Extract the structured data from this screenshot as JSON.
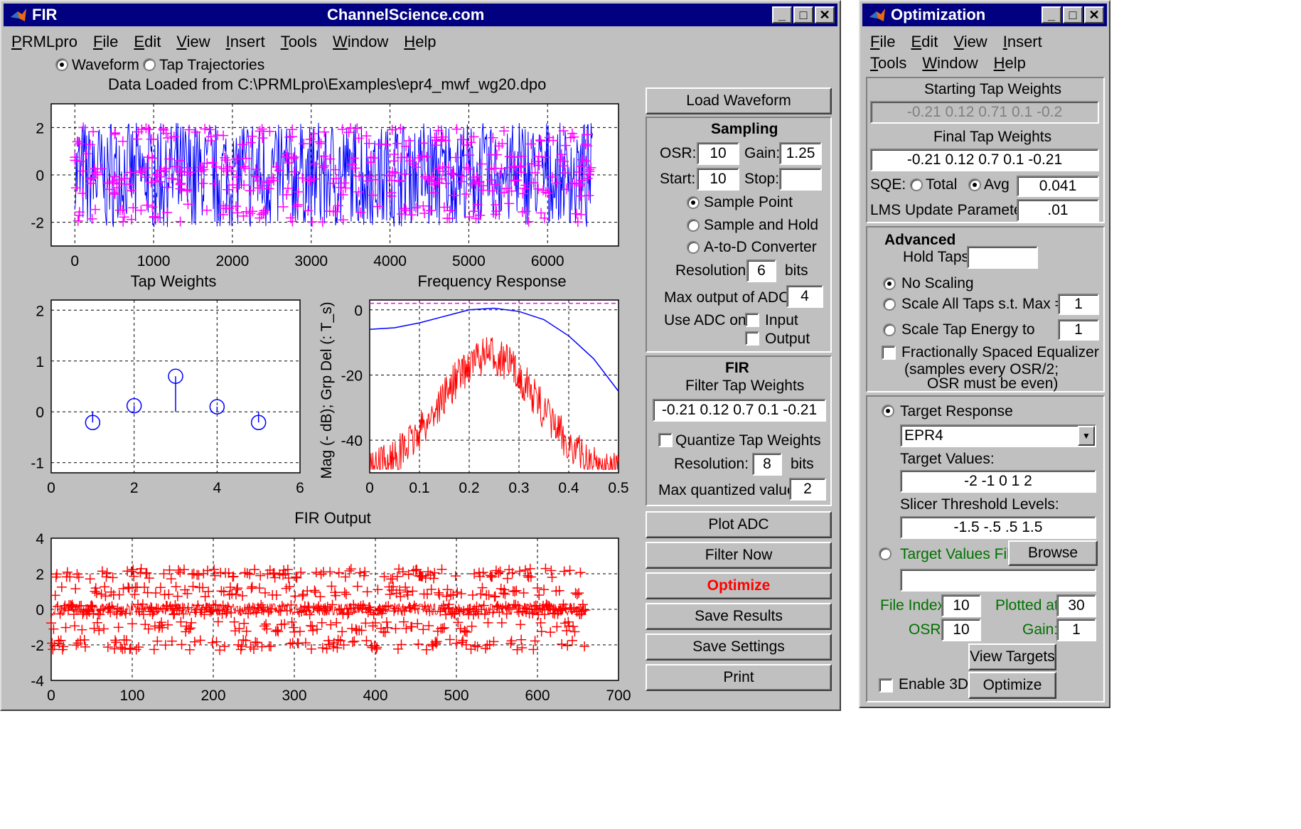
{
  "fir": {
    "title": "FIR",
    "site": "ChannelScience.com",
    "menu": [
      "PRMLpro",
      "File",
      "Edit",
      "View",
      "Insert",
      "Tools",
      "Window",
      "Help"
    ],
    "view_radio": {
      "waveform": "Waveform",
      "traj": "Tap Trajectories"
    },
    "data_loaded": "Data Loaded from C:\\PRMLpro\\Examples\\epr4_mwf_wg20.dpo",
    "buttons": {
      "load": "Load Waveform",
      "plot_adc": "Plot ADC",
      "filter_now": "Filter Now",
      "optimize": "Optimize",
      "save_results": "Save Results",
      "save_settings": "Save Settings",
      "print": "Print"
    },
    "sampling": {
      "title": "Sampling",
      "osr_label": "OSR:",
      "osr": "10",
      "gain_label": "Gain:",
      "gain": "1.25",
      "start_label": "Start:",
      "start": "10",
      "stop_label": "Stop:",
      "stop": "",
      "opt1": "Sample Point",
      "opt2": "Sample and Hold",
      "opt3": "A-to-D Converter",
      "res_label": "Resolution:",
      "res": "6",
      "bits": "bits",
      "maxadc_label": "Max output of ADC:",
      "maxadc": "4",
      "useadc": "Use ADC on",
      "input": "Input",
      "output": "Output"
    },
    "fir_panel": {
      "title": "FIR",
      "ftw_label": "Filter Tap Weights",
      "ftw": "-0.21 0.12 0.7 0.1 -0.21",
      "quantize": "Quantize Tap Weights",
      "res_label": "Resolution:",
      "res": "8",
      "bits": "bits",
      "maxq_label": "Max quantized value:",
      "maxq": "2"
    }
  },
  "opt": {
    "title": "Optimization",
    "menu": [
      "File",
      "Edit",
      "View",
      "Insert",
      "Tools",
      "Window",
      "Help"
    ],
    "start_label": "Starting Tap Weights",
    "start": "-0.21 0.12 0.71 0.1 -0.2",
    "final_label": "Final Tap Weights",
    "final": "-0.21 0.12 0.7 0.1 -0.21",
    "sqe": "SQE:",
    "total": "Total",
    "avg": "Avg",
    "sqe_val": "0.041",
    "lms_label": "LMS Update Parameter",
    "lms": ".01",
    "adv": "Advanced",
    "hold": "Hold Taps",
    "hold_val": "",
    "noscale": "No Scaling",
    "scale_max": "Scale All Taps s.t. Max =",
    "scale_max_val": "1",
    "scale_en": "Scale Tap Energy to",
    "scale_en_val": "1",
    "fse": "Fractionally Spaced Equalizer",
    "fse2": "(samples every OSR/2;",
    "fse3": "OSR must be even)",
    "target_resp": "Target Response",
    "target_sel": "EPR4",
    "tv_label": "Target Values:",
    "tv": "-2 -1 0 1 2",
    "slicer_label": "Slicer Threshold Levels:",
    "slicer": "-1.5 -.5 .5 1.5",
    "tvf": "Target Values File",
    "browse": "Browse",
    "tvf_val": "",
    "file_index": "File Index:",
    "file_index_val": "10",
    "plotted": "Plotted at:",
    "plotted_val": "30",
    "osr": "OSR:",
    "osr_val": "10",
    "gain": "Gain:",
    "gain_val": "1",
    "view_targets": "View Targets",
    "enable3d": "Enable 3D",
    "optimize": "Optimize"
  },
  "colors": {
    "title_bg": "#000080",
    "face": "#c0c0c0",
    "blue": "#0000ff",
    "magenta": "#ff00ff",
    "red": "#ff0000",
    "green": "#007000"
  },
  "chart_data": [
    {
      "type": "line",
      "title": "",
      "series": [
        {
          "name": "waveform",
          "color": "#0000ff"
        },
        {
          "name": "samples",
          "color": "#ff00ff",
          "marker": "+"
        }
      ],
      "xlim": [
        -300,
        6900
      ],
      "ylim": [
        -3,
        3
      ],
      "xticks": [
        "0",
        "1000",
        "2000",
        "3000",
        "4000",
        "5000",
        "6000"
      ],
      "yticks": [
        "2",
        "0",
        "-2"
      ],
      "grid": true
    },
    {
      "type": "stem",
      "title": "Tap Weights",
      "x": [
        1,
        2,
        3,
        4,
        5
      ],
      "values": [
        -0.21,
        0.12,
        0.7,
        0.1,
        -0.21
      ],
      "xlim": [
        0,
        6
      ],
      "ylim": [
        -1.2,
        2.2
      ],
      "xticks": [
        "0",
        "2",
        "4",
        "6"
      ],
      "yticks": [
        "2",
        "1",
        "0",
        "-1"
      ],
      "grid": true
    },
    {
      "type": "line",
      "title": "Frequency Response",
      "ylabel": "Mag (- dB); Grp Del (: T_s)",
      "xlim": [
        0,
        0.5
      ],
      "ylim": [
        -50,
        3
      ],
      "xticks": [
        "0",
        "0.1",
        "0.2",
        "0.3",
        "0.4",
        "0.5"
      ],
      "yticks": [
        "0",
        "-20",
        "-40"
      ],
      "grid": true,
      "series": [
        {
          "name": "magnitude",
          "color": "#0000ff",
          "x": [
            0,
            0.05,
            0.1,
            0.15,
            0.2,
            0.25,
            0.3,
            0.35,
            0.4,
            0.45,
            0.5
          ],
          "y": [
            -6,
            -5.5,
            -4,
            -2,
            0,
            0.5,
            -0.5,
            -3,
            -8,
            -15,
            -25
          ]
        },
        {
          "name": "group delay",
          "color": "#ff00ff",
          "dashed": true,
          "x": [
            0,
            0.5
          ],
          "y": [
            2,
            2
          ]
        },
        {
          "name": "spectrum",
          "color": "#ff0000"
        }
      ]
    },
    {
      "type": "scatter",
      "title": "FIR Output",
      "xlim": [
        0,
        700
      ],
      "ylim": [
        -4,
        4
      ],
      "xticks": [
        "0",
        "100",
        "200",
        "300",
        "400",
        "500",
        "600",
        "700"
      ],
      "yticks": [
        "4",
        "2",
        "0",
        "-2",
        "-4"
      ],
      "grid": true,
      "series": [
        {
          "name": "output",
          "color": "#ff0000",
          "marker": "+"
        }
      ]
    }
  ]
}
